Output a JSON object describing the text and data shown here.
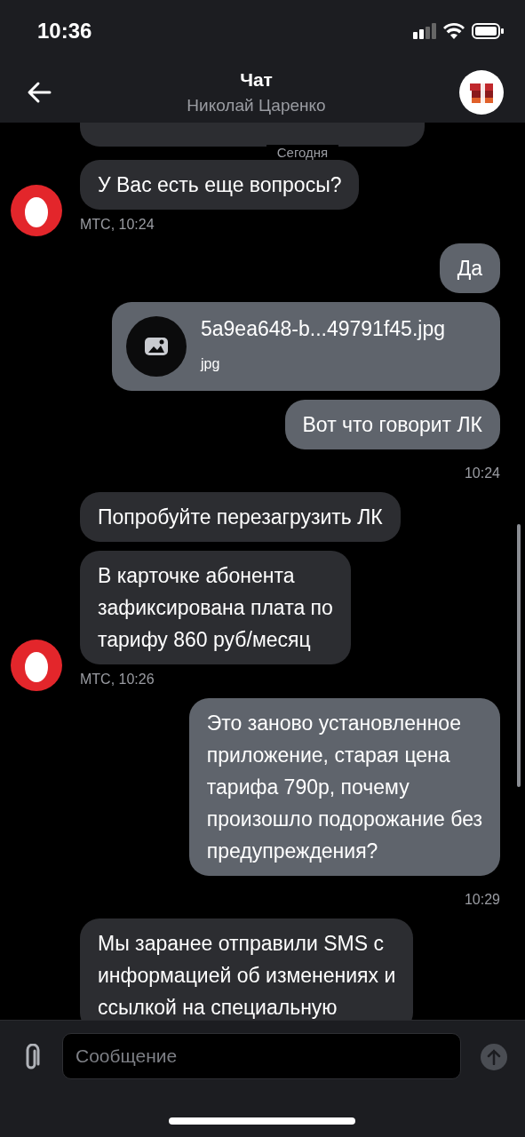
{
  "status_bar": {
    "time": "10:36"
  },
  "header": {
    "title": "Чат",
    "subtitle": "Николай Царенко"
  },
  "date_label": "Сегодня",
  "groups": [
    {
      "kind": "incoming",
      "bubbles": [
        {
          "kind": "cut"
        },
        {
          "kind": "text",
          "text": "У Вас есть еще вопросы?"
        }
      ],
      "meta": "МТС, 10:24"
    },
    {
      "kind": "outgoing",
      "bubbles": [
        {
          "kind": "text",
          "text": "Да"
        },
        {
          "kind": "file",
          "name": "5a9ea648-b...49791f45.jpg",
          "ext": "jpg"
        },
        {
          "kind": "text",
          "text": "Вот что говорит ЛК"
        }
      ],
      "meta": "10:24"
    },
    {
      "kind": "incoming",
      "bubbles": [
        {
          "kind": "text",
          "text": "Попробуйте перезагрузить ЛК"
        },
        {
          "kind": "text",
          "text": "В карточке абонента\nзафиксирована плата по\nтарифу 860 руб/месяц"
        }
      ],
      "meta": "МТС, 10:26"
    },
    {
      "kind": "outgoing",
      "bubbles": [
        {
          "kind": "text",
          "text": "Это заново установленное\nприложение, старая цена\nтарифа 790р, почему\nпроизошло подорожание без\nпредупреждения?"
        }
      ],
      "meta": "10:29"
    },
    {
      "kind": "incoming",
      "bubbles": [
        {
          "kind": "text",
          "text": "Мы заранее отправили SMS с\nинформацией об изменениях и\nссылкой на специальную"
        }
      ]
    }
  ],
  "composer": {
    "placeholder": "Сообщение"
  }
}
